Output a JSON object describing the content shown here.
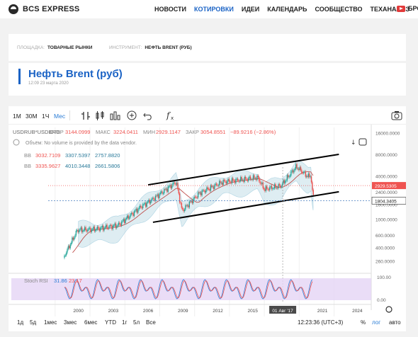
{
  "header": {
    "brand": "BCS EXPRESS",
    "nav": [
      "НОВОСТИ",
      "КОТИРОВКИ",
      "ИДЕИ",
      "КАЛЕНДАРЬ",
      "СООБЩЕСТВО",
      "ТЕХАНАЛИЗ"
    ],
    "active_nav": "КОТИРОВКИ",
    "youtube_label": "БРОК"
  },
  "filters": {
    "exchange_key": "ПЛОЩАДКА:",
    "exchange_value": "ТОВАРНЫЕ РЫНКИ",
    "instrument_key": "ИНСТРУМЕНТ:",
    "instrument_value": "НЕФТЬ BRENT (РУБ)"
  },
  "page": {
    "title": "Нефть Brent (руб)",
    "timestamp": "12:09 23 марта 2020"
  },
  "toolbar": {
    "intervals": [
      "1М",
      "30М",
      "1Ч",
      "Мес"
    ],
    "active_interval": "Мес"
  },
  "chart_info": {
    "symbol": "USDRUB*USDBRO",
    "otkr_label": "ОТКР",
    "otkr": "3144.0999",
    "maks_label": "МАКС",
    "maks": "3224.0411",
    "min_label": "МИН",
    "min": "2929.1147",
    "zakr_label": "ЗАКР",
    "zakr": "3054.8551",
    "change": "−89.9216 (−2.86%)",
    "volume_note": "Объём: No volume is provided by the data vendor.",
    "bb1_label": "BB",
    "bb1": [
      "3032.7109",
      "3307.5397",
      "2757.8820"
    ],
    "bb2_label": "BB",
    "bb2": [
      "3335.9627",
      "4010.3448",
      "2661.5806"
    ],
    "stoch_label": "Stoch RSI",
    "stoch_k": "31.86",
    "stoch_d": "23.17"
  },
  "chart_data": {
    "type": "line",
    "title": "USDRUB*USDBRO",
    "y_scale": "log",
    "y_ticks": [
      "16000.0000",
      "8000.0000",
      "4000.0000",
      "2400.0000",
      "1804.3405",
      "1600.0000",
      "1000.0000",
      "600.0000",
      "400.0000",
      "260.0000"
    ],
    "current_price_label": "2929.5305",
    "support_price_label": "1804.3405",
    "x_ticks": [
      "2000",
      "2003",
      "2006",
      "2009",
      "2012",
      "2015",
      "01 Авг '17",
      "2021",
      "2024"
    ],
    "stoch_y_ticks": [
      "100.00",
      "0.00"
    ],
    "price_approx": [
      {
        "date": "1998-09",
        "close": 280
      },
      {
        "date": "1999-12",
        "close": 700
      },
      {
        "date": "2001-06",
        "close": 720
      },
      {
        "date": "2003-06",
        "close": 820
      },
      {
        "date": "2005-06",
        "close": 1500
      },
      {
        "date": "2006-06",
        "close": 1900
      },
      {
        "date": "2008-06",
        "close": 3300
      },
      {
        "date": "2008-12",
        "close": 1300
      },
      {
        "date": "2010-06",
        "close": 2300
      },
      {
        "date": "2012-06",
        "close": 3300
      },
      {
        "date": "2014-06",
        "close": 3600
      },
      {
        "date": "2015-06",
        "close": 3800
      },
      {
        "date": "2016-01",
        "close": 2600
      },
      {
        "date": "2017-06",
        "close": 2900
      },
      {
        "date": "2018-10",
        "close": 5400
      },
      {
        "date": "2019-10",
        "close": 3900
      },
      {
        "date": "2020-01",
        "close": 4100
      },
      {
        "date": "2020-03",
        "close": 2100
      }
    ],
    "trendlines": [
      {
        "from": {
          "date": "2006-01",
          "value": 3000
        },
        "to": {
          "date": "2022-06",
          "value": 8000
        }
      },
      {
        "from": {
          "date": "2006-06",
          "value": 900
        },
        "to": {
          "date": "2022-06",
          "value": 2400
        }
      }
    ]
  },
  "bottom": {
    "ranges": [
      "1д",
      "5д",
      "1мес",
      "3мес",
      "6мес",
      "YTD",
      "1г",
      "5л",
      "Все"
    ],
    "clock": "12:23:36 (UTC+3)",
    "percent_label": "%",
    "log_label": "лог",
    "auto_label": "авто"
  },
  "colors": {
    "accent": "#1b63c5",
    "up": "#26a69a",
    "down": "#ef5350",
    "band": "#b8d8e4",
    "stoch_bg": "#e5d5f5"
  }
}
